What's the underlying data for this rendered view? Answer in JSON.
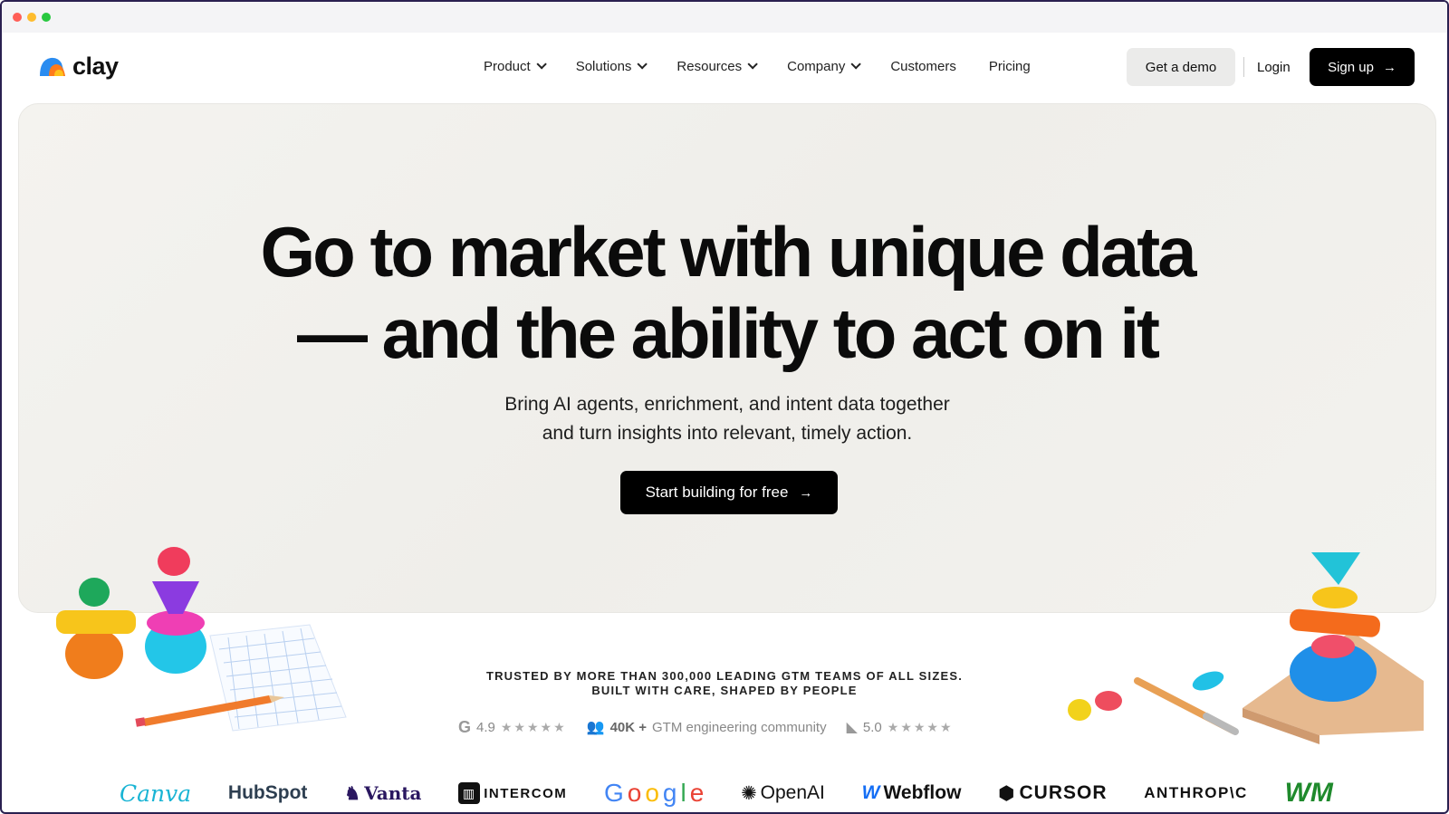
{
  "browser": {
    "controls": [
      "close",
      "minimize",
      "maximize"
    ]
  },
  "nav": {
    "logo_text": "clay",
    "menu": [
      {
        "label": "Product",
        "dropdown": true
      },
      {
        "label": "Solutions",
        "dropdown": true
      },
      {
        "label": "Resources",
        "dropdown": true
      },
      {
        "label": "Company",
        "dropdown": true
      },
      {
        "label": "Customers",
        "dropdown": false
      },
      {
        "label": "Pricing",
        "dropdown": false
      }
    ],
    "demo_label": "Get a demo",
    "login_label": "Login",
    "signup_label": "Sign up"
  },
  "hero": {
    "headline_line1": "Go to market with unique data",
    "headline_line2": "— and the ability to act on it",
    "subhead_line1": "Bring AI agents, enrichment, and intent data together",
    "subhead_line2": "and turn insights into relevant, timely action.",
    "cta_label": "Start building for free"
  },
  "trust": {
    "line1": "TRUSTED BY MORE THAN 300,000 LEADING GTM TEAMS OF ALL SIZES.",
    "line2": "BUILT WITH CARE, SHAPED BY PEOPLE",
    "g2_rating": "4.9",
    "community_count": "40K +",
    "community_label": "GTM engineering community",
    "capterra_rating": "5.0",
    "stars": "★★★★★"
  },
  "customers": [
    "Canva",
    "HubSpot",
    "Vanta",
    "INTERCOM",
    "Google",
    "OpenAI",
    "Webflow",
    "CURSOR",
    "ANTHROP\\C",
    "WM"
  ],
  "colors": {
    "accent_black": "#000000",
    "hero_bg": "#f1f0ec",
    "demo_bg": "#ebebea"
  }
}
